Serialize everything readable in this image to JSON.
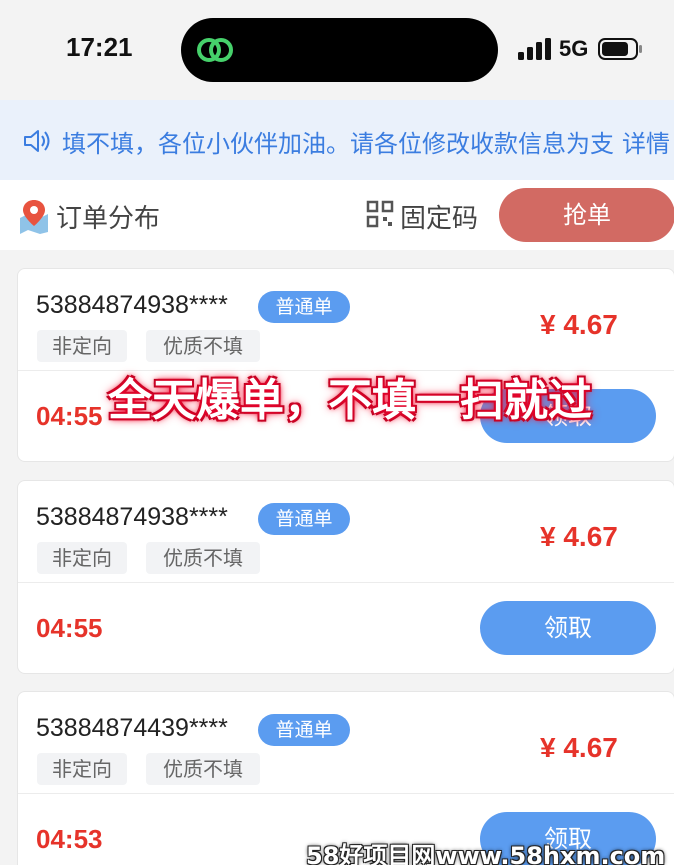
{
  "status_bar": {
    "time": "17:21",
    "network": "5G"
  },
  "notice": {
    "text": "填不填，各位小伙伴加油。请各位修改收款信息为支",
    "more": "详情"
  },
  "toolbar": {
    "order_distribution": "订单分布",
    "fixed_code": "固定码",
    "grab_button": "抢单"
  },
  "orders": [
    {
      "order_no": "53884874938****",
      "type": "普通单",
      "tags": [
        "非定向",
        "优质不填"
      ],
      "price": "¥ 4.67",
      "countdown": "04:55",
      "button": "领取"
    },
    {
      "order_no": "53884874938****",
      "type": "普通单",
      "tags": [
        "非定向",
        "优质不填"
      ],
      "price": "¥ 4.67",
      "countdown": "04:55",
      "button": "领取"
    },
    {
      "order_no": "53884874439****",
      "type": "普通单",
      "tags": [
        "非定向",
        "优质不填"
      ],
      "price": "¥ 4.67",
      "countdown": "04:53",
      "button": "领取"
    }
  ],
  "overlay": {
    "promo_text": "全天爆单，不填一扫就过",
    "watermark": "58好项目网www.58hxm.com"
  },
  "colors": {
    "accent_blue": "#5b9cf0",
    "price_red": "#e6332a",
    "grab_red": "#d26a63",
    "notice_bg": "#eaf1fb"
  }
}
